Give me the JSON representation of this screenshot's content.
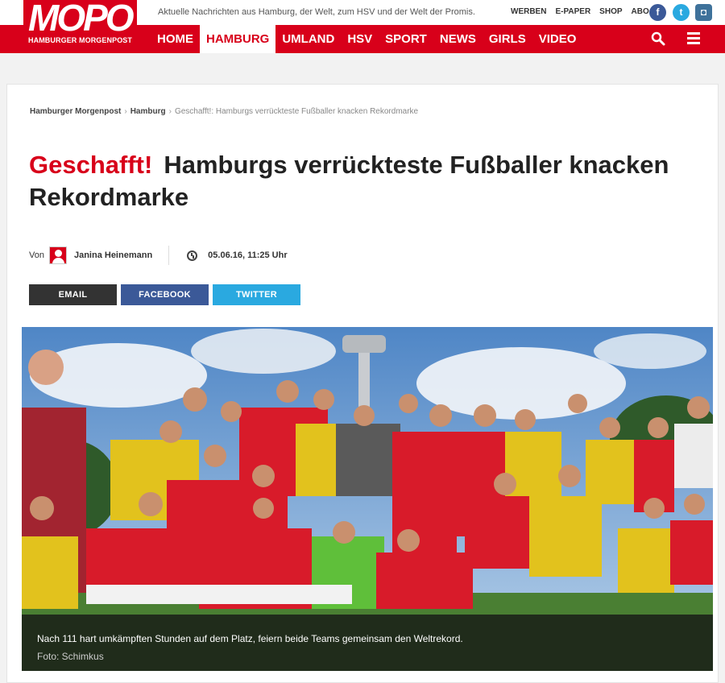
{
  "logo": {
    "text": "MOPO",
    "subtitle": "HAMBURGER MORGENPOST"
  },
  "tagline": "Aktuelle Nachrichten aus Hamburg, der Welt, zum HSV und der Welt der Promis.",
  "top_links": [
    "WERBEN",
    "E-PAPER",
    "SHOP",
    "ABO"
  ],
  "social": {
    "facebook": "f",
    "twitter": "t",
    "instagram": "◘"
  },
  "nav": [
    "HOME",
    "HAMBURG",
    "UMLAND",
    "HSV",
    "SPORT",
    "NEWS",
    "GIRLS",
    "VIDEO"
  ],
  "nav_active": "HAMBURG",
  "breadcrumb": [
    "Hamburger Morgenpost",
    "Hamburg",
    "Geschafft!: Hamburgs verrückteste Fußballer knacken Rekordmarke"
  ],
  "article": {
    "kicker": "Geschafft!",
    "title": "Hamburgs verrückteste Fußballer knacken Rekordmarke",
    "by_label": "Von",
    "author": "Janina Heinemann",
    "date": "05.06.16, 11:25 Uhr"
  },
  "share": {
    "email": "EMAIL",
    "facebook": "FACEBOOK",
    "twitter": "TWITTER"
  },
  "photo": {
    "caption": "Nach 111 hart umkämpften Stunden auf dem Platz, feiern beide Teams gemeinsam den Weltrekord.",
    "credit": "Foto: Schimkus"
  },
  "colors": {
    "brand": "#d8001a",
    "facebook": "#3b5998",
    "twitter": "#2aa9e0",
    "email": "#333333"
  }
}
